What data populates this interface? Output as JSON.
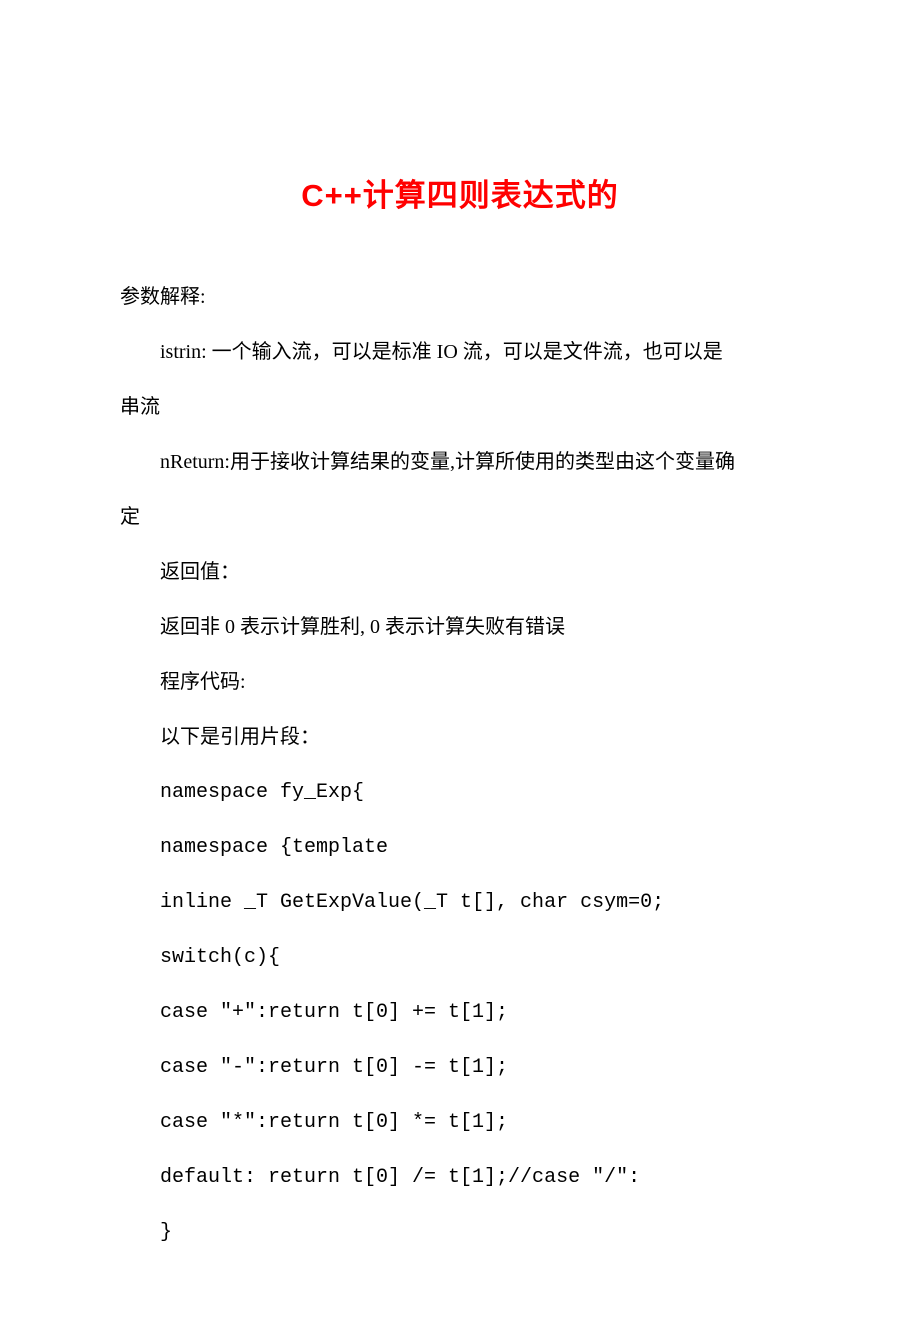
{
  "title": "C++计算四则表达式的",
  "lines": [
    {
      "text": "参数解释:",
      "indent": false
    },
    {
      "text": "istrin: 一个输入流，可以是标准 IO 流，可以是文件流，也可以是",
      "indent": true
    },
    {
      "text": "串流",
      "indent": false
    },
    {
      "text": "nReturn:用于接收计算结果的变量,计算所使用的类型由这个变量确",
      "indent": true
    },
    {
      "text": "定",
      "indent": false
    },
    {
      "text": "返回值：",
      "indent": true
    },
    {
      "text": "返回非 0 表示计算胜利, 0 表示计算失败有错误",
      "indent": true
    },
    {
      "text": "程序代码:",
      "indent": true
    },
    {
      "text": "以下是引用片段：",
      "indent": true
    },
    {
      "text": "namespace fy_Exp{",
      "indent": true,
      "code": true
    },
    {
      "text": "namespace {template",
      "indent": true,
      "code": true
    },
    {
      "text": "inline _T GetExpValue(_T t[], char csym=0;",
      "indent": true,
      "code": true
    },
    {
      "text": "switch(c){",
      "indent": true,
      "code": true
    },
    {
      "text": "case \"+\":return t[0] += t[1];",
      "indent": true,
      "code": true
    },
    {
      "text": "case \"-\":return t[0] -= t[1];",
      "indent": true,
      "code": true
    },
    {
      "text": "case \"*\":return t[0] *= t[1];",
      "indent": true,
      "code": true
    },
    {
      "text": "default: return t[0] /= t[1];//case \"/\":",
      "indent": true,
      "code": true
    },
    {
      "text": "}",
      "indent": true,
      "code": true
    }
  ]
}
